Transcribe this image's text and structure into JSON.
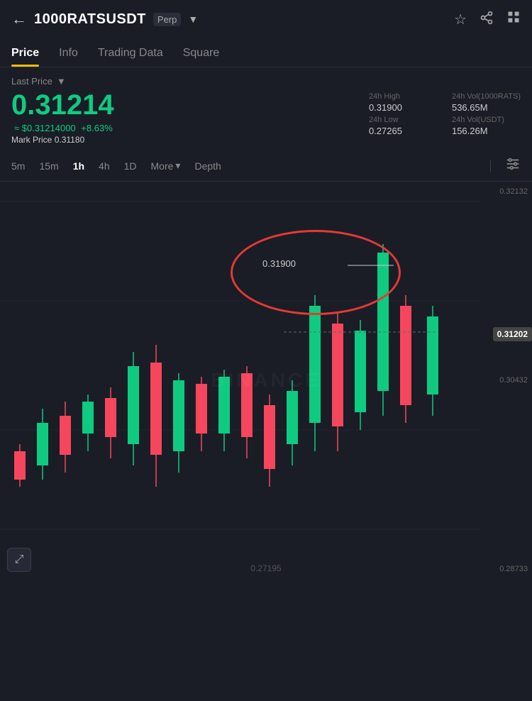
{
  "header": {
    "back_label": "←",
    "title": "1000RATSUSDT",
    "badge": "Perp",
    "dropdown_icon": "▼",
    "star_icon": "☆",
    "share_icon": "share",
    "grid_icon": "grid"
  },
  "tabs": [
    {
      "id": "price",
      "label": "Price",
      "active": true
    },
    {
      "id": "info",
      "label": "Info",
      "active": false
    },
    {
      "id": "trading-data",
      "label": "Trading Data",
      "active": false
    },
    {
      "id": "square",
      "label": "Square",
      "active": false
    }
  ],
  "price_section": {
    "last_price_label": "Last Price",
    "main_price": "0.31214",
    "usd_price": "≈ $0.31214000",
    "change_pct": "+8.63%",
    "mark_price_label": "Mark Price",
    "mark_price_value": "0.31180",
    "stats": [
      {
        "label": "24h High",
        "value": "0.31900"
      },
      {
        "label": "24h Vol(1000RATS)",
        "value": "536.65M"
      },
      {
        "label": "24h Low",
        "value": "0.27265"
      },
      {
        "label": "24h Vol(USDT)",
        "value": "156.26M"
      }
    ]
  },
  "timeframes": [
    {
      "label": "5m",
      "active": false
    },
    {
      "label": "15m",
      "active": false
    },
    {
      "label": "1h",
      "active": true
    },
    {
      "label": "4h",
      "active": false
    },
    {
      "label": "1D",
      "active": false
    }
  ],
  "more_label": "More",
  "depth_label": "Depth",
  "chart": {
    "watermark": "BINANCE",
    "current_price_tag": "0.31202",
    "annotation_price": "0.31900",
    "y_labels": [
      "0.32132",
      "0.30432",
      "0.28733"
    ],
    "bottom_price": "0.27195"
  },
  "restore_icon": "⤢"
}
